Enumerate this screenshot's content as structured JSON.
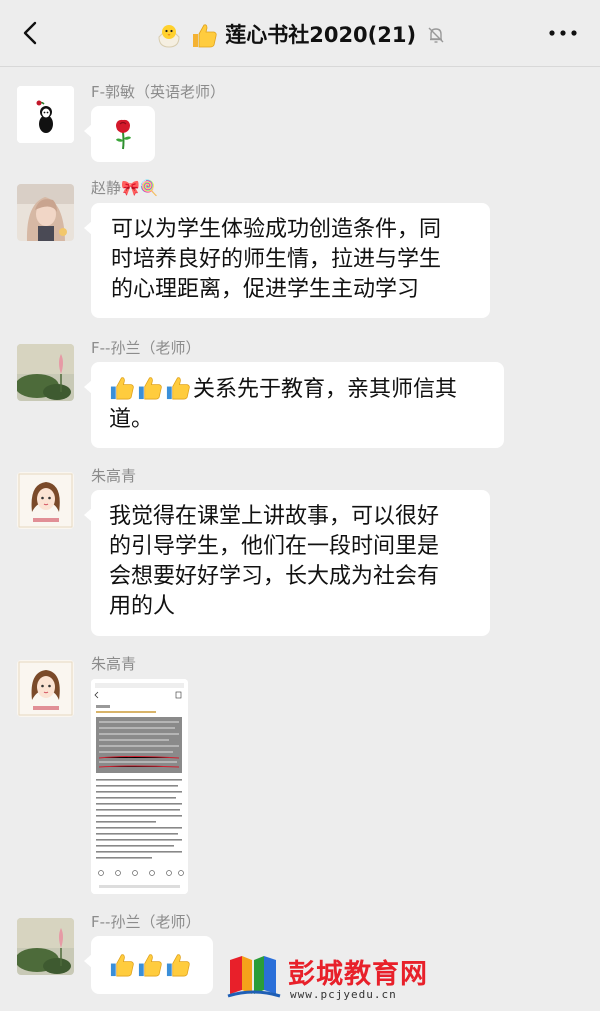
{
  "header": {
    "title": "莲心书社2020(21)",
    "emoji_1": "chick-emoji",
    "emoji_2": "thumbs-up-emoji",
    "muted_icon": "bell-muted-icon"
  },
  "messages": [
    {
      "sender": "F-郭敏（英语老师）",
      "content_type": "emoji",
      "content": "rose-emoji"
    },
    {
      "sender": "赵静🎀🍭",
      "content_type": "text",
      "lines": [
        "可以为学生体验成功创造条件，同",
        "时培养良好的师生情，拉进与学生",
        "的心理距离，促进学生主动学习"
      ]
    },
    {
      "sender": "F--孙兰（老师）",
      "content_type": "text",
      "lines": [
        "关系先于教育，亲其师信其",
        "道。"
      ],
      "leading_emojis": 3
    },
    {
      "sender": "朱高青",
      "content_type": "text",
      "lines": [
        "我觉得在课堂上讲故事，可以很好",
        "的引导学生，他们在一段时间里是",
        "会想要好好学习，长大成为社会有",
        "用的人"
      ]
    },
    {
      "sender": "朱高青",
      "content_type": "image"
    },
    {
      "sender": "F--孙兰（老师）",
      "content_type": "emoji",
      "emoji_count": 3
    }
  ],
  "watermark": {
    "name": "彭城教育网",
    "url": "www.pcjyedu.cn"
  },
  "colors": {
    "background": "#ededed",
    "bubble": "#ffffff",
    "name": "#8c8c8c",
    "watermark_red": "#e8202a"
  }
}
